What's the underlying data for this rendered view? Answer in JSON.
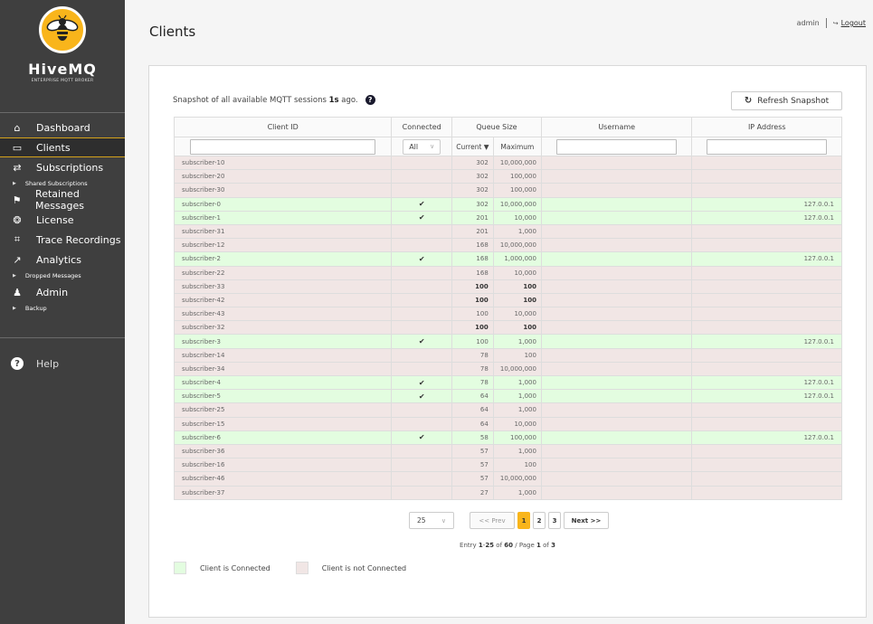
{
  "brand": {
    "name_big": "Hive",
    "name_mq": "MQ",
    "subtitle": "ENTERPRISE MQTT BROKER"
  },
  "sidebar": {
    "items": [
      {
        "label": "Dashboard",
        "icon": "home-icon",
        "glyph": "⌂",
        "active": false,
        "subs": []
      },
      {
        "label": "Clients",
        "icon": "clients-icon",
        "glyph": "▭",
        "active": true,
        "subs": []
      },
      {
        "label": "Subscriptions",
        "icon": "shuffle-icon",
        "glyph": "⇄",
        "active": false,
        "subs": [
          "Shared Subscriptions"
        ]
      },
      {
        "label": "Retained Messages",
        "icon": "flag-icon",
        "glyph": "⚑",
        "active": false,
        "subs": []
      },
      {
        "label": "License",
        "icon": "award-icon",
        "glyph": "❂",
        "active": false,
        "subs": []
      },
      {
        "label": "Trace Recordings",
        "icon": "laptop-search-icon",
        "glyph": "⌗",
        "active": false,
        "subs": []
      },
      {
        "label": "Analytics",
        "icon": "chart-icon",
        "glyph": "↗",
        "active": false,
        "subs": [
          "Dropped Messages"
        ]
      },
      {
        "label": "Admin",
        "icon": "user-icon",
        "glyph": "♟",
        "active": false,
        "subs": [
          "Backup"
        ]
      }
    ],
    "help": "Help"
  },
  "header": {
    "title": "Clients",
    "user": "admin",
    "logout": "Logout"
  },
  "snapshot": {
    "prefix": "Snapshot of all available MQTT sessions ",
    "age": "1s",
    "suffix": " ago.",
    "refresh_label": "Refresh Snapshot"
  },
  "table": {
    "headers": {
      "client_id": "Client ID",
      "connected": "Connected",
      "queue_size": "Queue Size",
      "current": "Current ▼",
      "maximum": "Maximum",
      "username": "Username",
      "ip": "IP Address"
    },
    "filters": {
      "client_id": "",
      "connected": "All",
      "username": "",
      "ip": ""
    },
    "rows": [
      {
        "id": "subscriber-10",
        "connected": false,
        "current": "302",
        "max": "10,000,000",
        "username": "",
        "ip": "",
        "bold": false
      },
      {
        "id": "subscriber-20",
        "connected": false,
        "current": "302",
        "max": "100,000",
        "username": "",
        "ip": "",
        "bold": false
      },
      {
        "id": "subscriber-30",
        "connected": false,
        "current": "302",
        "max": "100,000",
        "username": "",
        "ip": "",
        "bold": false
      },
      {
        "id": "subscriber-0",
        "connected": true,
        "current": "302",
        "max": "10,000,000",
        "username": "",
        "ip": "127.0.0.1",
        "bold": false
      },
      {
        "id": "subscriber-1",
        "connected": true,
        "current": "201",
        "max": "10,000",
        "username": "",
        "ip": "127.0.0.1",
        "bold": false
      },
      {
        "id": "subscriber-31",
        "connected": false,
        "current": "201",
        "max": "1,000",
        "username": "",
        "ip": "",
        "bold": false
      },
      {
        "id": "subscriber-12",
        "connected": false,
        "current": "168",
        "max": "10,000,000",
        "username": "",
        "ip": "",
        "bold": false
      },
      {
        "id": "subscriber-2",
        "connected": true,
        "current": "168",
        "max": "1,000,000",
        "username": "",
        "ip": "127.0.0.1",
        "bold": false
      },
      {
        "id": "subscriber-22",
        "connected": false,
        "current": "168",
        "max": "10,000",
        "username": "",
        "ip": "",
        "bold": false
      },
      {
        "id": "subscriber-33",
        "connected": false,
        "current": "100",
        "max": "100",
        "username": "",
        "ip": "",
        "bold": true
      },
      {
        "id": "subscriber-42",
        "connected": false,
        "current": "100",
        "max": "100",
        "username": "",
        "ip": "",
        "bold": true
      },
      {
        "id": "subscriber-43",
        "connected": false,
        "current": "100",
        "max": "10,000",
        "username": "",
        "ip": "",
        "bold": false
      },
      {
        "id": "subscriber-32",
        "connected": false,
        "current": "100",
        "max": "100",
        "username": "",
        "ip": "",
        "bold": true
      },
      {
        "id": "subscriber-3",
        "connected": true,
        "current": "100",
        "max": "1,000",
        "username": "",
        "ip": "127.0.0.1",
        "bold": false
      },
      {
        "id": "subscriber-14",
        "connected": false,
        "current": "78",
        "max": "100",
        "username": "",
        "ip": "",
        "bold": false
      },
      {
        "id": "subscriber-34",
        "connected": false,
        "current": "78",
        "max": "10,000,000",
        "username": "",
        "ip": "",
        "bold": false
      },
      {
        "id": "subscriber-4",
        "connected": true,
        "current": "78",
        "max": "1,000",
        "username": "",
        "ip": "127.0.0.1",
        "bold": false
      },
      {
        "id": "subscriber-5",
        "connected": true,
        "current": "64",
        "max": "1,000",
        "username": "",
        "ip": "127.0.0.1",
        "bold": false
      },
      {
        "id": "subscriber-25",
        "connected": false,
        "current": "64",
        "max": "1,000",
        "username": "",
        "ip": "",
        "bold": false
      },
      {
        "id": "subscriber-15",
        "connected": false,
        "current": "64",
        "max": "10,000",
        "username": "",
        "ip": "",
        "bold": false
      },
      {
        "id": "subscriber-6",
        "connected": true,
        "current": "58",
        "max": "100,000",
        "username": "",
        "ip": "127.0.0.1",
        "bold": false
      },
      {
        "id": "subscriber-36",
        "connected": false,
        "current": "57",
        "max": "1,000",
        "username": "",
        "ip": "",
        "bold": false
      },
      {
        "id": "subscriber-16",
        "connected": false,
        "current": "57",
        "max": "100",
        "username": "",
        "ip": "",
        "bold": false
      },
      {
        "id": "subscriber-46",
        "connected": false,
        "current": "57",
        "max": "10,000,000",
        "username": "",
        "ip": "",
        "bold": false
      },
      {
        "id": "subscriber-37",
        "connected": false,
        "current": "27",
        "max": "1,000",
        "username": "",
        "ip": "",
        "bold": false
      }
    ]
  },
  "pagination": {
    "per_page": "25",
    "prev": "<< Prev",
    "pages": [
      "1",
      "2",
      "3"
    ],
    "current_page": "1",
    "next": "Next >>",
    "entry": {
      "word": "Entry ",
      "from": "1",
      "dash": "-",
      "to": "25",
      "of": " of ",
      "total": "60",
      "page_word": " / Page ",
      "page": "1",
      "of2": " of ",
      "pages": "3"
    }
  },
  "legend": {
    "connected": "Client is Connected",
    "not_connected": "Client is not Connected"
  },
  "colors": {
    "accent": "#f9b51b",
    "connected_row": "#e3fde0",
    "disconnected_row": "#f1e6e5",
    "sidebar_bg": "#3f3f3f"
  }
}
